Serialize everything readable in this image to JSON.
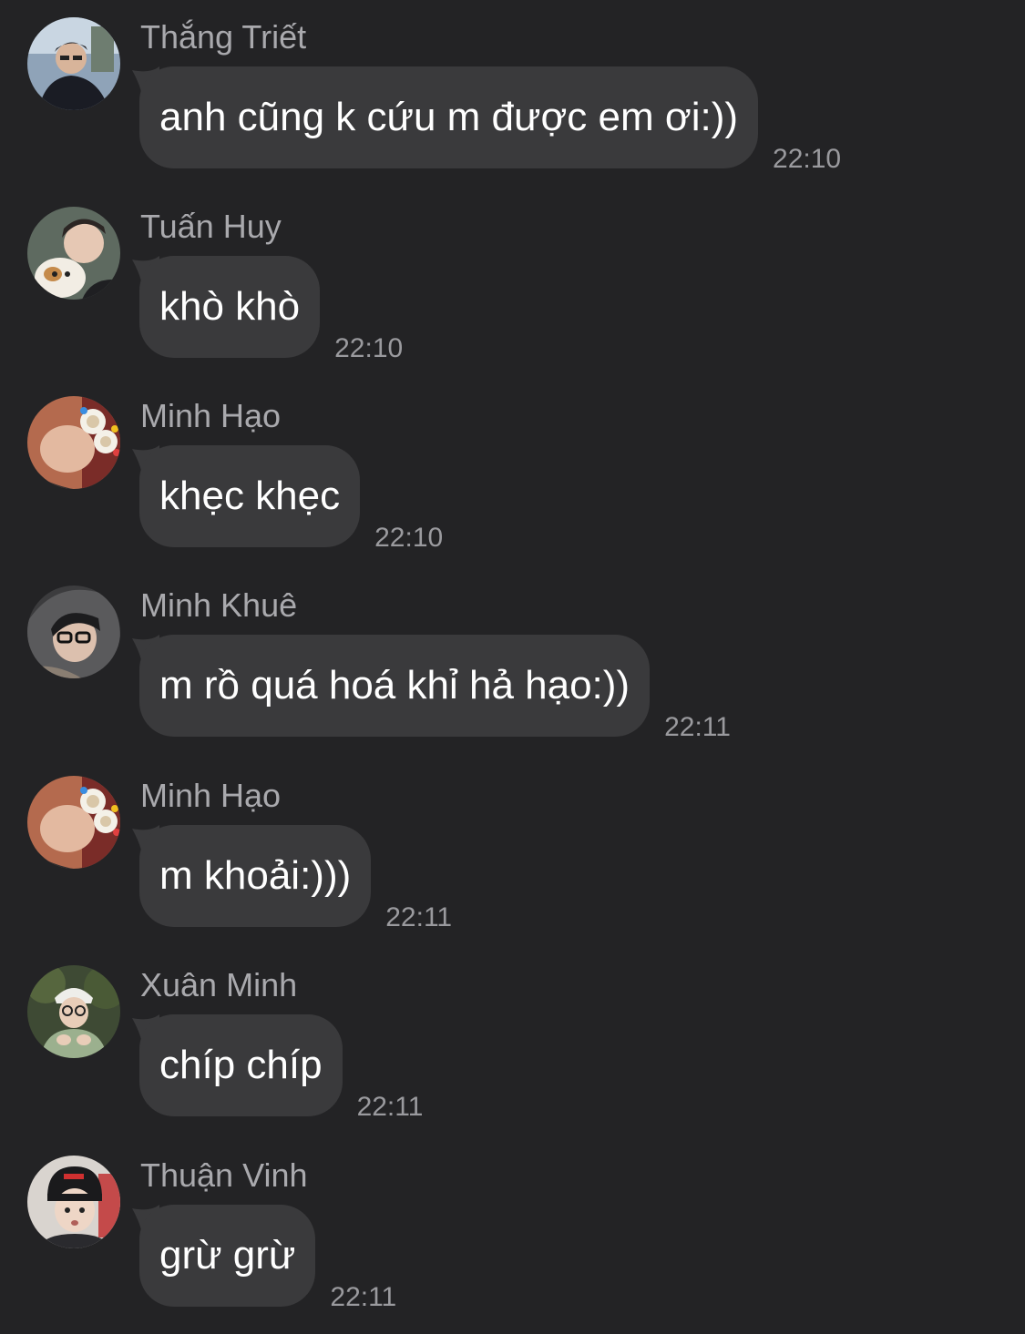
{
  "messages": [
    {
      "sender": "Thắng Triết",
      "text": "anh cũng k cứu m được em ơi:))",
      "time": "22:10",
      "avatar": "avatar-thang-triet"
    },
    {
      "sender": "Tuấn Huy",
      "text": "khò khò",
      "time": "22:10",
      "avatar": "avatar-tuan-huy"
    },
    {
      "sender": "Minh Hạo",
      "text": "khẹc khẹc",
      "time": "22:10",
      "avatar": "avatar-minh-hao"
    },
    {
      "sender": "Minh Khuê",
      "text": "m rồ quá hoá khỉ hả hạo:))",
      "time": "22:11",
      "avatar": "avatar-minh-khue"
    },
    {
      "sender": "Minh Hạo",
      "text": "m khoải:)))",
      "time": "22:11",
      "avatar": "avatar-minh-hao"
    },
    {
      "sender": "Xuân Minh",
      "text": "chíp chíp",
      "time": "22:11",
      "avatar": "avatar-xuan-minh"
    },
    {
      "sender": "Thuận Vinh",
      "text": "grừ grừ",
      "time": "22:11",
      "avatar": "avatar-thuan-vinh"
    }
  ],
  "colors": {
    "background": "#232325",
    "bubble": "#3a3a3c",
    "sender": "#a9a9ad",
    "time": "#9a9a9e",
    "text": "#ffffff"
  }
}
